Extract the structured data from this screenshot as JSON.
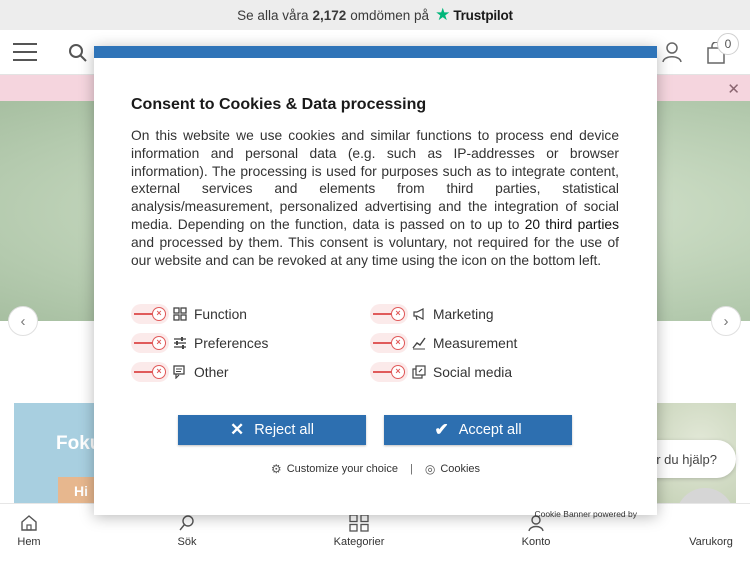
{
  "trustbar": {
    "prefix": "Se alla våra",
    "count": "2,172",
    "suffix": "omdömen på",
    "brand": "Trustpilot"
  },
  "header": {
    "logo_fragment": "",
    "cart_count": "0"
  },
  "tiles": {
    "left_title": "Foku",
    "left_sub": "Hi"
  },
  "help": {
    "text": "er du hjälp?"
  },
  "bottom_nav": [
    {
      "label": "Hem"
    },
    {
      "label": "Sök"
    },
    {
      "label": "Kategorier"
    },
    {
      "label": "Konto"
    },
    {
      "label": "Varukorg"
    }
  ],
  "cookie": {
    "title": "Consent to Cookies & Data processing",
    "body_before": "On this website we use cookies and similar functions to process end device information and personal data (e.g. such as IP-addresses or browser information). The processing is used for purposes such as to integrate content, external services and elements from third parties, statistical analysis/measurement, personalized advertising and the integration of social media. Depending on the function, data is passed on to up to ",
    "body_link": "20 third parties",
    "body_after": " and processed by them. This consent is voluntary, not required for the use of our website and can be revoked at any time using the icon on the bottom left.",
    "options_left": [
      {
        "label": "Function",
        "icon": "grid-icon",
        "enabled": false
      },
      {
        "label": "Preferences",
        "icon": "sliders-icon",
        "enabled": false
      },
      {
        "label": "Other",
        "icon": "chat-icon",
        "enabled": false
      }
    ],
    "options_right": [
      {
        "label": "Marketing",
        "icon": "megaphone-icon",
        "enabled": false
      },
      {
        "label": "Measurement",
        "icon": "chart-icon",
        "enabled": false
      },
      {
        "label": "Social media",
        "icon": "share-icon",
        "enabled": false
      }
    ],
    "reject_label": "Reject all",
    "accept_label": "Accept all",
    "customize_label": "Customize your choice",
    "separator": "|",
    "cookies_label": "Cookies",
    "powered_by": "Cookie Banner powered by",
    "accent_color": "#2f74b8",
    "toggle_off_color": "#e05a5a"
  }
}
